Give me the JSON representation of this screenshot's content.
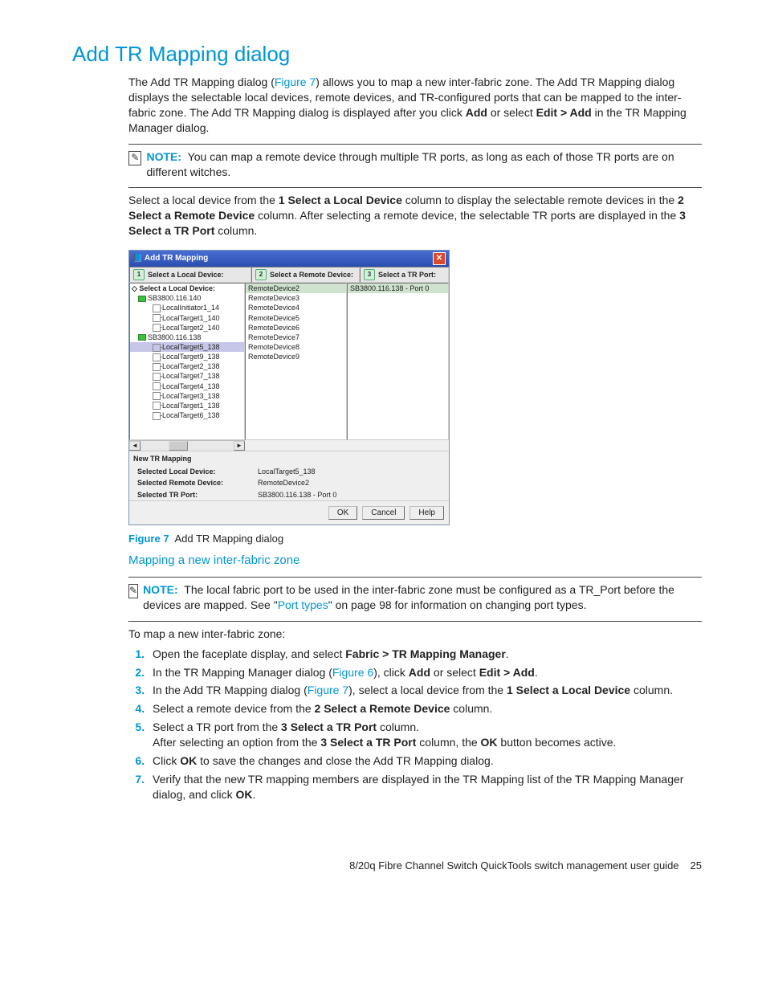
{
  "heading": "Add TR Mapping dialog",
  "intro": {
    "t1a": "The Add TR Mapping dialog (",
    "fig7": "Figure 7",
    "t1b": ") allows you to map a new inter-fabric zone. The Add TR Mapping dialog displays the selectable local devices, remote devices, and TR-configured ports that can be mapped to the inter-fabric zone. The Add TR Mapping dialog is displayed after you click ",
    "add": "Add",
    "t1c": " or select ",
    "editadd": "Edit > Add",
    "t1d": " in the TR Mapping Manager dialog."
  },
  "note1": {
    "label": "NOTE:",
    "text": "You can map a remote device through multiple TR ports, as long as each of those TR ports are on different               witches."
  },
  "para2": {
    "a": "Select a local device from the ",
    "b1": "1 Select a Local Device",
    "c": " column to display the selectable remote devices in the ",
    "b2": "2 Select a Remote Device",
    "d": " column. After selecting a remote device, the selectable TR ports are displayed in the ",
    "b3": "3 Select a TR Port",
    "e": " column."
  },
  "dialog": {
    "title": "Add TR Mapping",
    "cols": [
      "Select a Local Device:",
      "Select a Remote Device:",
      "Select a TR Port:"
    ],
    "treeTop": "Select a Local Device:",
    "tree": [
      {
        "lvl": 0,
        "icon": "sq",
        "label": "SB3800.116.140"
      },
      {
        "lvl": 1,
        "icon": "port",
        "label": "LocalInitiator1_14"
      },
      {
        "lvl": 1,
        "icon": "port",
        "label": "LocalTarget1_140"
      },
      {
        "lvl": 1,
        "icon": "port",
        "label": "LocalTarget2_140"
      },
      {
        "lvl": 0,
        "icon": "sq",
        "label": "SB3800.116.138"
      },
      {
        "lvl": 1,
        "icon": "port",
        "label": "LocalTarget5_138",
        "sel": true
      },
      {
        "lvl": 1,
        "icon": "port",
        "label": "LocalTarget9_138"
      },
      {
        "lvl": 1,
        "icon": "port",
        "label": "LocalTarget2_138"
      },
      {
        "lvl": 1,
        "icon": "port",
        "label": "LocalTarget7_138"
      },
      {
        "lvl": 1,
        "icon": "port",
        "label": "LocalTarget4_138"
      },
      {
        "lvl": 1,
        "icon": "port",
        "label": "LocalTarget3_138"
      },
      {
        "lvl": 1,
        "icon": "port",
        "label": "LocalTarget1_138"
      },
      {
        "lvl": 1,
        "icon": "port",
        "label": "LocalTarget6_138"
      }
    ],
    "remote": [
      "RemoteDevice2",
      "RemoteDevice3",
      "RemoteDevice4",
      "RemoteDevice5",
      "RemoteDevice6",
      "RemoteDevice7",
      "RemoteDevice8",
      "RemoteDevice9"
    ],
    "remoteSel": 0,
    "ports": [
      "SB3800.116.138 - Port 0"
    ],
    "portSel": 0,
    "sectionTitle": "New TR Mapping",
    "kv": [
      {
        "k": "Selected Local Device:",
        "v": "LocalTarget5_138"
      },
      {
        "k": "Selected Remote Device:",
        "v": "RemoteDevice2"
      },
      {
        "k": "Selected TR Port:",
        "v": "SB3800.116.138 - Port 0"
      }
    ],
    "buttons": [
      "OK",
      "Cancel",
      "Help"
    ]
  },
  "figcap": {
    "fig": "Figure 7",
    "text": "Add TR Mapping dialog"
  },
  "subhead": "Mapping a new inter-fabric zone",
  "note2": {
    "label": "NOTE:",
    "a": "The local fabric port to be used in the inter-fabric zone must be configured as a TR_Port before the devices are mapped. See \"",
    "link": "Port types",
    "b": "\" on page 98 for information on changing port types."
  },
  "steps_intro": "To map a new inter-fabric zone:",
  "steps": [
    {
      "pre": "Open the faceplate display, and select ",
      "b1": "Fabric > TR Mapping Manager",
      "post": "."
    },
    {
      "pre": "In the TR Mapping Manager dialog (",
      "link": "Figure 6",
      "mid": "), click ",
      "b1": "Add",
      "mid2": " or select ",
      "b2": "Edit > Add",
      "post": "."
    },
    {
      "pre": "In the Add TR Mapping dialog (",
      "link": "Figure 7",
      "mid": "), select a local device from the ",
      "b1": "1 Select a Local Device",
      "post": " column."
    },
    {
      "pre": "Select a remote device from the ",
      "b1": "2 Select a Remote Device",
      "post": " column."
    },
    {
      "pre": "Select a TR port from the ",
      "b1": "3 Select a TR Port",
      "post": " column.",
      "line2a": "After selecting an option from the ",
      "line2b": "3 Select a TR Port",
      "line2c": " column, the ",
      "line2d": "OK",
      "line2e": " button becomes active."
    },
    {
      "pre": "Click ",
      "b1": "OK",
      "post": " to save the changes and close the Add TR Mapping dialog."
    },
    {
      "pre": "Verify that the new TR mapping members are displayed in the TR Mapping list of the TR Mapping Manager dialog, and click ",
      "b1": "OK",
      "post": "."
    }
  ],
  "footer": {
    "text": "8/20q Fibre Channel Switch QuickTools switch management user guide",
    "page": "25"
  }
}
